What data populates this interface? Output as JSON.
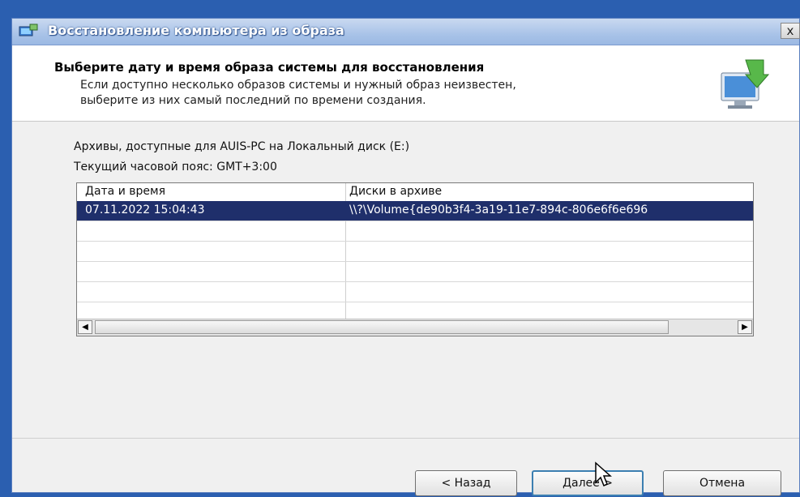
{
  "window": {
    "title": "Восстановление компьютера из образа",
    "close_label": "x"
  },
  "header": {
    "title": "Выберите дату и время образа системы для восстановления",
    "description_line1": "Если доступно несколько образов системы и нужный образ неизвестен,",
    "description_line2": "выберите из них самый последний по времени создания."
  },
  "content": {
    "archives_label": "Архивы, доступные для AUIS-PC на Локальный диск (E:)",
    "timezone_label": "Текущий часовой пояс: GMT+3:00"
  },
  "table": {
    "columns": [
      "Дата и время",
      "Диски в архиве"
    ],
    "rows": [
      {
        "datetime": "07.11.2022 15:04:43",
        "disks": "\\\\?\\Volume{de90b3f4-3a19-11e7-894c-806e6f6e696",
        "selected": true
      }
    ]
  },
  "buttons": {
    "back": "< Назад",
    "next": "Далее >",
    "cancel": "Отмена"
  },
  "colors": {
    "selection": "#1f2f6b",
    "titlebar": "#a9c3e8",
    "desktop": "#2b5fb0"
  }
}
